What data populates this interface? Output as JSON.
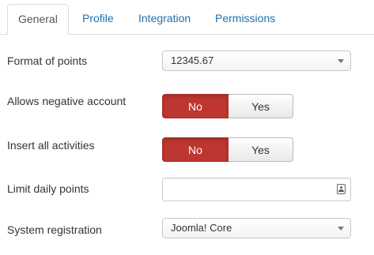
{
  "tabs": [
    {
      "label": "General",
      "active": true
    },
    {
      "label": "Profile",
      "active": false
    },
    {
      "label": "Integration",
      "active": false
    },
    {
      "label": "Permissions",
      "active": false
    }
  ],
  "form": {
    "format_of_points": {
      "label": "Format of points",
      "value": "12345.67"
    },
    "allows_negative_account": {
      "label": "Allows negative account",
      "no_label": "No",
      "yes_label": "Yes",
      "selected": "No"
    },
    "insert_all_activities": {
      "label": "Insert all activities",
      "no_label": "No",
      "yes_label": "Yes",
      "selected": "No"
    },
    "limit_daily_points": {
      "label": "Limit daily points",
      "value": ""
    },
    "system_registration": {
      "label": "System registration",
      "value": "Joomla! Core"
    }
  },
  "colors": {
    "tab_link": "#1f6fae",
    "toggle_active": "#bd362f",
    "border": "#dddddd"
  },
  "icons": {
    "dropdown": "chevron-down-icon",
    "limit_field": "contact-card-icon"
  }
}
